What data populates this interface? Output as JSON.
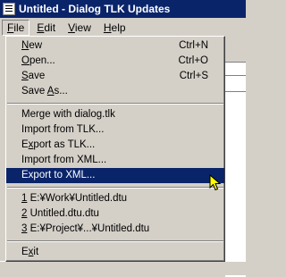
{
  "window": {
    "title": "Untitled - Dialog TLK Updates",
    "icon": "document-icon"
  },
  "menubar": [
    {
      "label": "File",
      "mnemonic": "F",
      "rest": "ile",
      "open": true
    },
    {
      "label": "Edit",
      "mnemonic": "E",
      "rest": "dit"
    },
    {
      "label": "View",
      "mnemonic": "V",
      "rest": "iew"
    },
    {
      "label": "Help",
      "mnemonic": "H",
      "rest": "elp"
    }
  ],
  "file_menu": {
    "new": {
      "pre": "",
      "m": "N",
      "post": "ew",
      "shortcut": "Ctrl+N"
    },
    "open": {
      "pre": "",
      "m": "O",
      "post": "pen...",
      "shortcut": "Ctrl+O"
    },
    "save": {
      "pre": "",
      "m": "S",
      "post": "ave",
      "shortcut": "Ctrl+S"
    },
    "save_as": {
      "pre": "Save ",
      "m": "A",
      "post": "s..."
    },
    "merge": {
      "pre": "Merge with dialog.tlk",
      "m": "",
      "post": ""
    },
    "import_tlk": {
      "pre": "Import from TLK...",
      "m": "",
      "post": ""
    },
    "export_tlk": {
      "pre": "E",
      "m": "x",
      "post": "port as TLK..."
    },
    "import_xml": {
      "pre": "Import from XML...",
      "m": "",
      "post": ""
    },
    "export_xml": {
      "pre": "Export to XML...",
      "m": "",
      "post": "",
      "highlighted": true
    },
    "recent1": {
      "pre": "",
      "m": "1",
      "post": " E:¥Work¥Untitled.dtu"
    },
    "recent2": {
      "pre": "",
      "m": "2",
      "post": " Untitled.dtu.dtu"
    },
    "recent3": {
      "pre": "",
      "m": "3",
      "post": " E:¥Project¥...¥Untitled.dtu"
    },
    "exit": {
      "pre": "E",
      "m": "x",
      "post": "it"
    }
  },
  "colors": {
    "face": "#d4d0c8",
    "highlight": "#0a246a",
    "titlebar": "#0a246a"
  }
}
